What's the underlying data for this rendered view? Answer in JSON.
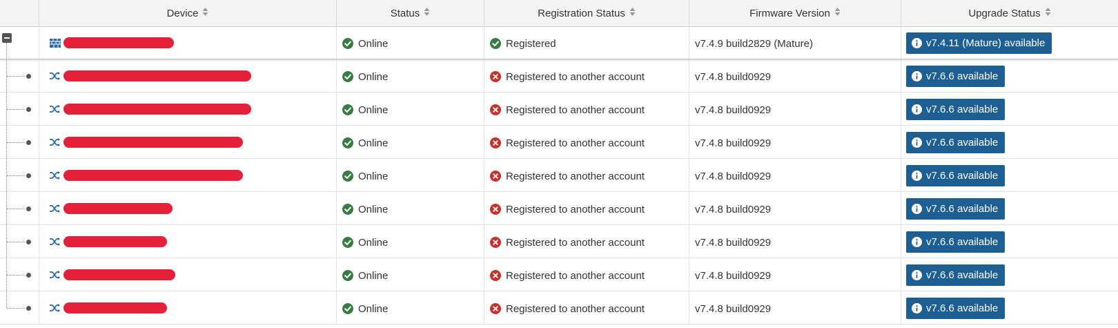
{
  "colors": {
    "online_green": "#3a7d44",
    "error_red": "#c9302c",
    "button_blue": "#1e5f93",
    "redaction_red": "#e5203a"
  },
  "columns": {
    "device": "Device",
    "status": "Status",
    "registration": "Registration Status",
    "firmware": "Firmware Version",
    "upgrade": "Upgrade Status"
  },
  "parent": {
    "device_icon": "fortigate-icon",
    "status": "Online",
    "registration": "Registered",
    "firmware": "v7.4.9 build2829 (Mature)",
    "upgrade": "v7.4.11 (Mature) available"
  },
  "children": [
    {
      "device_icon": "switch-icon",
      "status": "Online",
      "registration": "Registered to another account",
      "firmware": "v7.4.8 build0929",
      "upgrade": "v7.6.6 available"
    },
    {
      "device_icon": "switch-icon",
      "status": "Online",
      "registration": "Registered to another account",
      "firmware": "v7.4.8 build0929",
      "upgrade": "v7.6.6 available"
    },
    {
      "device_icon": "switch-icon",
      "status": "Online",
      "registration": "Registered to another account",
      "firmware": "v7.4.8 build0929",
      "upgrade": "v7.6.6 available"
    },
    {
      "device_icon": "switch-icon",
      "status": "Online",
      "registration": "Registered to another account",
      "firmware": "v7.4.8 build0929",
      "upgrade": "v7.6.6 available"
    },
    {
      "device_icon": "switch-icon",
      "status": "Online",
      "registration": "Registered to another account",
      "firmware": "v7.4.8 build0929",
      "upgrade": "v7.6.6 available"
    },
    {
      "device_icon": "switch-icon",
      "status": "Online",
      "registration": "Registered to another account",
      "firmware": "v7.4.8 build0929",
      "upgrade": "v7.6.6 available"
    },
    {
      "device_icon": "switch-icon",
      "status": "Online",
      "registration": "Registered to another account",
      "firmware": "v7.4.8 build0929",
      "upgrade": "v7.6.6 available"
    },
    {
      "device_icon": "switch-icon",
      "status": "Online",
      "registration": "Registered to another account",
      "firmware": "v7.4.8 build0929",
      "upgrade": "v7.6.6 available"
    }
  ]
}
